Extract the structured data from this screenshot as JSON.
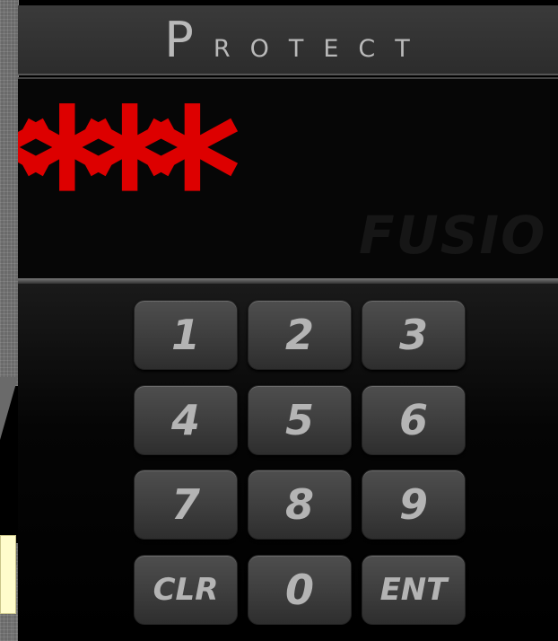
{
  "title": "Protect",
  "display": {
    "pin_mask": "****",
    "watermark": "FUSIO"
  },
  "keypad": {
    "keys": [
      "1",
      "2",
      "3",
      "4",
      "5",
      "6",
      "7",
      "8",
      "9",
      "CLR",
      "0",
      "ENT"
    ]
  },
  "colors": {
    "pin": "#dd0000",
    "key_text": "#b4b4b4",
    "title_text": "#b9b9b9"
  }
}
